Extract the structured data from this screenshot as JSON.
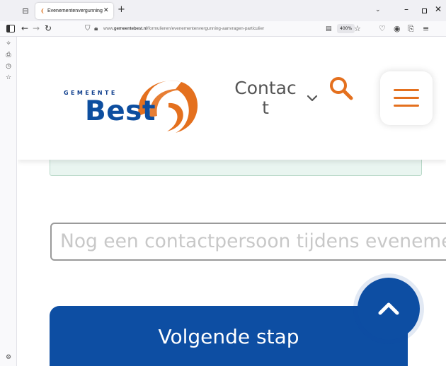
{
  "browser": {
    "tab_title": "Evenementenvergunning aanvr",
    "tab_close": "✕",
    "new_tab": "+",
    "url_prefix": "www.",
    "url_domain": "gemeentebest.nl",
    "url_path": "/formulieren/evenementenvergunning-aanvragen-particulier",
    "zoom": "400%",
    "icons": [
      "tab-overview-icon",
      "sidebar-toggle-icon",
      "back-icon",
      "forward-icon",
      "reload-icon",
      "shield-icon",
      "lock-icon",
      "reader-view-icon",
      "bookmark-star-icon",
      "pocket-icon",
      "account-icon",
      "extensions-icon",
      "menu-icon",
      "tabs-list-icon",
      "minimize-icon",
      "maximize-icon",
      "close-icon"
    ]
  },
  "sidebar": {
    "icons": [
      "ai-chat-icon",
      "synced-tabs-icon",
      "history-icon",
      "bookmarks-icon",
      "customize-sidebar-icon"
    ]
  },
  "site": {
    "logo_top": "GEMEENTE",
    "logo_main": "Best",
    "contact_label": "Contact",
    "search_icon": "search-icon",
    "menu_icon": "hamburger-menu-icon",
    "accent_color": "#e4701e",
    "brand_color": "#0d4ea3"
  },
  "form": {
    "contact_placeholder": "Nog een contactpersoon tijdens evenement",
    "next_button": "Volgende stap",
    "back_to_top_icon": "chevron-up-icon"
  }
}
